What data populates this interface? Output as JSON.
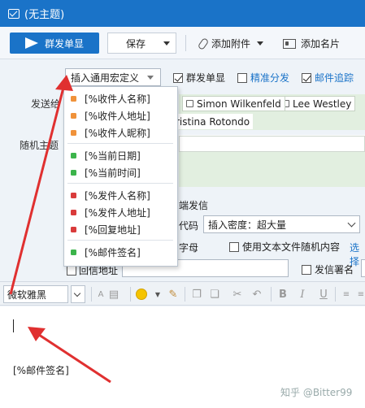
{
  "window": {
    "title": "(无主题)"
  },
  "toolbar": {
    "send_label": "群发单显",
    "save_label": "保存",
    "attach_label": "添加附件",
    "card_label": "添加名片"
  },
  "options": {
    "macro_button": "插入通用宏定义",
    "bulk_single": "群发单显",
    "precise": "精准分发",
    "tracking": "邮件追踪"
  },
  "fields": {
    "to_label": "发送给",
    "subject_label": "随机主题"
  },
  "recipients": [
    "Simon Wilkenfeld",
    "Lee Westley",
    "ristina Rotondo"
  ],
  "send_settings": {
    "send_label_partial": "端发信",
    "code_label_partial": "代码",
    "density_value": "插入密度：超大量",
    "letters_label_partial": "字母",
    "random_text_label": "使用文本文件随机内容",
    "select_link": "选择",
    "mail_addr_label": "回信地址",
    "sign_label": "发信署名"
  },
  "format": {
    "font_value": "微软雅黑"
  },
  "macro_menu": {
    "items": [
      {
        "label": "[%收件人名称]",
        "color": "#f0923a"
      },
      {
        "label": "[%收件人地址]",
        "color": "#f0923a"
      },
      {
        "label": "[%收件人昵称]",
        "color": "#f0923a"
      },
      {
        "label": "[%当前日期]",
        "color": "#3cb44b"
      },
      {
        "label": "[%当前时间]",
        "color": "#3cb44b"
      },
      {
        "label": "[%发件人名称]",
        "color": "#d93b3b"
      },
      {
        "label": "[%发件人地址]",
        "color": "#d93b3b"
      },
      {
        "label": "[%回复地址]",
        "color": "#d93b3b"
      },
      {
        "label": "[%邮件签名]",
        "color": "#3cb44b"
      }
    ]
  },
  "editor": {
    "signature": "[%邮件签名]"
  },
  "watermark": "知乎 @Bitter99",
  "colors": {
    "brand": "#1a73c8",
    "arrow": "#e03030"
  }
}
